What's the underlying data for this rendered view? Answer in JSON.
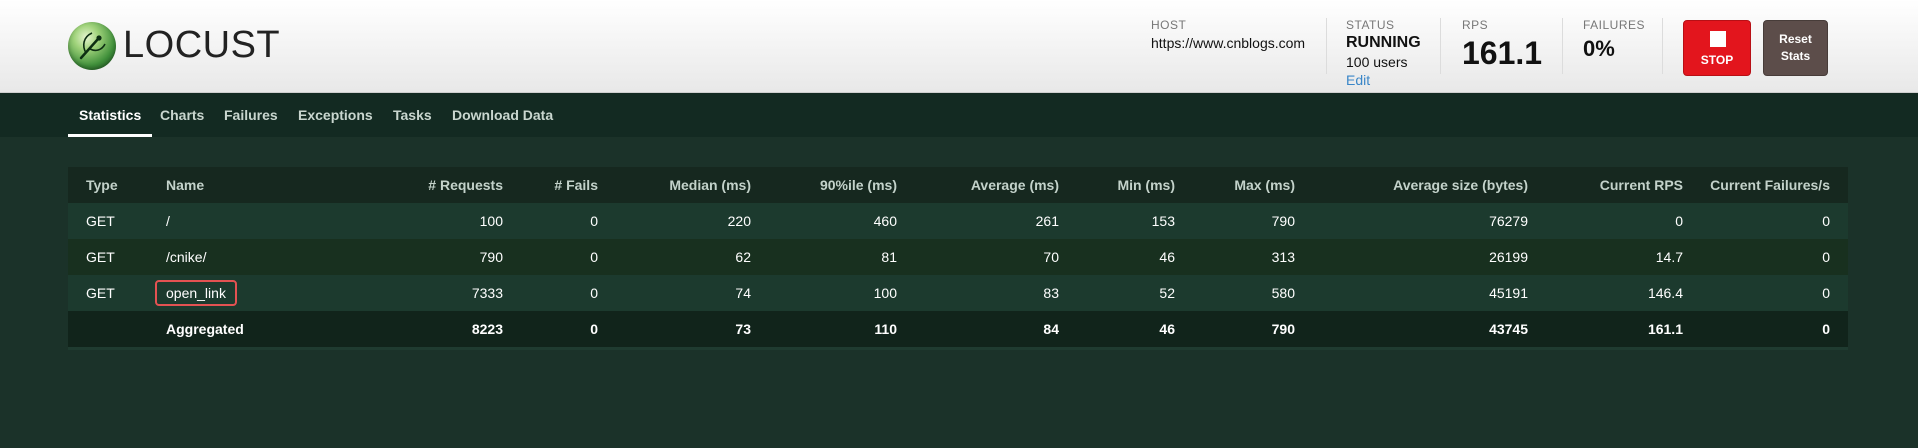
{
  "header": {
    "logo_text": "LOCUST",
    "host": {
      "label": "HOST",
      "value": "https://www.cnblogs.com"
    },
    "status": {
      "label": "STATUS",
      "value": "RUNNING",
      "users": "100 users",
      "edit": "Edit"
    },
    "rps": {
      "label": "RPS",
      "value": "161.1"
    },
    "failures": {
      "label": "FAILURES",
      "value": "0%"
    },
    "stop_label": "STOP",
    "reset_label_line1": "Reset",
    "reset_label_line2": "Stats"
  },
  "nav": {
    "tabs": [
      {
        "label": "Statistics",
        "active": true
      },
      {
        "label": "Charts"
      },
      {
        "label": "Failures"
      },
      {
        "label": "Exceptions"
      },
      {
        "label": "Tasks"
      },
      {
        "label": "Download Data"
      }
    ]
  },
  "table": {
    "columns": [
      "Type",
      "Name",
      "# Requests",
      "# Fails",
      "Median (ms)",
      "90%ile (ms)",
      "Average (ms)",
      "Min (ms)",
      "Max (ms)",
      "Average size (bytes)",
      "Current RPS",
      "Current Failures/s"
    ],
    "rows": [
      [
        "GET",
        "/",
        "100",
        "0",
        "220",
        "460",
        "261",
        "153",
        "790",
        "76279",
        "0",
        "0"
      ],
      [
        "GET",
        "/cnike/",
        "790",
        "0",
        "62",
        "81",
        "70",
        "46",
        "313",
        "26199",
        "14.7",
        "0"
      ],
      [
        "GET",
        "open_link",
        "7333",
        "0",
        "74",
        "100",
        "83",
        "52",
        "580",
        "45191",
        "146.4",
        "0"
      ]
    ],
    "aggregated": [
      "",
      "Aggregated",
      "8223",
      "0",
      "73",
      "110",
      "84",
      "46",
      "790",
      "43745",
      "161.1",
      "0"
    ]
  },
  "colors": {
    "background": "#1b3229",
    "stop_button": "#e3151d",
    "reset_button": "#5c4d4a",
    "highlight_box": "#e35252"
  }
}
